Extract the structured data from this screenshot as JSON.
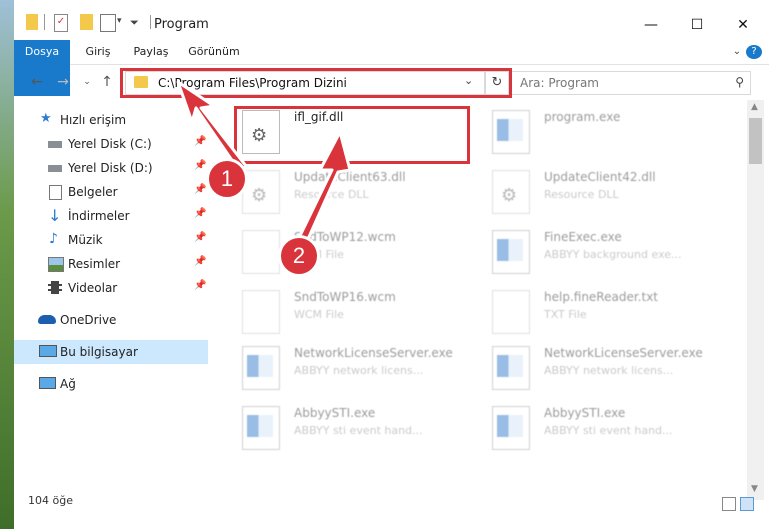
{
  "window": {
    "title": "Program",
    "controls": {
      "minimize": "—",
      "maximize": "☐",
      "close": "✕"
    }
  },
  "ribbon": {
    "tabs": [
      "Dosya",
      "Giriş",
      "Paylaş",
      "Görünüm"
    ],
    "help_icon": "?"
  },
  "address": {
    "path": "C:\\Program Files\\Program Dizini",
    "search_placeholder": "Ara: Program"
  },
  "sidebar": {
    "items": [
      {
        "label": "Hızlı erişim",
        "icon": "star-icon"
      },
      {
        "label": "Yerel Disk (C:)",
        "icon": "drive-icon",
        "pinned": true
      },
      {
        "label": "Yerel Disk (D:)",
        "icon": "drive-icon",
        "pinned": true
      },
      {
        "label": "Belgeler",
        "icon": "documents-icon",
        "pinned": true
      },
      {
        "label": "İndirmeler",
        "icon": "download-icon",
        "pinned": true
      },
      {
        "label": "Müzik",
        "icon": "music-icon",
        "pinned": true
      },
      {
        "label": "Resimler",
        "icon": "pictures-icon",
        "pinned": true
      },
      {
        "label": "Videolar",
        "icon": "videos-icon",
        "pinned": true
      },
      {
        "label": "OneDrive",
        "icon": "cloud-icon"
      },
      {
        "label": "Bu bilgisayar",
        "icon": "computer-icon",
        "selected": true
      },
      {
        "label": "Ağ",
        "icon": "network-icon"
      }
    ]
  },
  "files": [
    {
      "name": "ifl_gif.dll",
      "desc": "",
      "highlighted": true
    },
    {
      "name": "program.exe",
      "desc": ""
    },
    {
      "name": "UpdateClient63.dll",
      "desc": "Resource DLL"
    },
    {
      "name": "UpdateClient42.dll",
      "desc": "Resource DLL"
    },
    {
      "name": "SndToWP12.wcm",
      "desc": "WCM File"
    },
    {
      "name": "FineExec.exe",
      "desc": "ABBYY background exe..."
    },
    {
      "name": "SndToWP16.wcm",
      "desc": "WCM File"
    },
    {
      "name": "help.fineReader.txt",
      "desc": "TXT File"
    },
    {
      "name": "NetworkLicenseServer.exe",
      "desc": "ABBYY network licens..."
    },
    {
      "name": "NetworkLicenseServer.exe",
      "desc": "ABBYY network licens..."
    },
    {
      "name": "AbbyySTI.exe",
      "desc": "ABBYY sti event hand..."
    },
    {
      "name": "AbbyySTI.exe",
      "desc": "ABBYY sti event hand..."
    }
  ],
  "status": {
    "count_text": "104 öğe"
  },
  "annotations": {
    "step1": "1",
    "step2": "2",
    "accent": "#d9343b"
  }
}
